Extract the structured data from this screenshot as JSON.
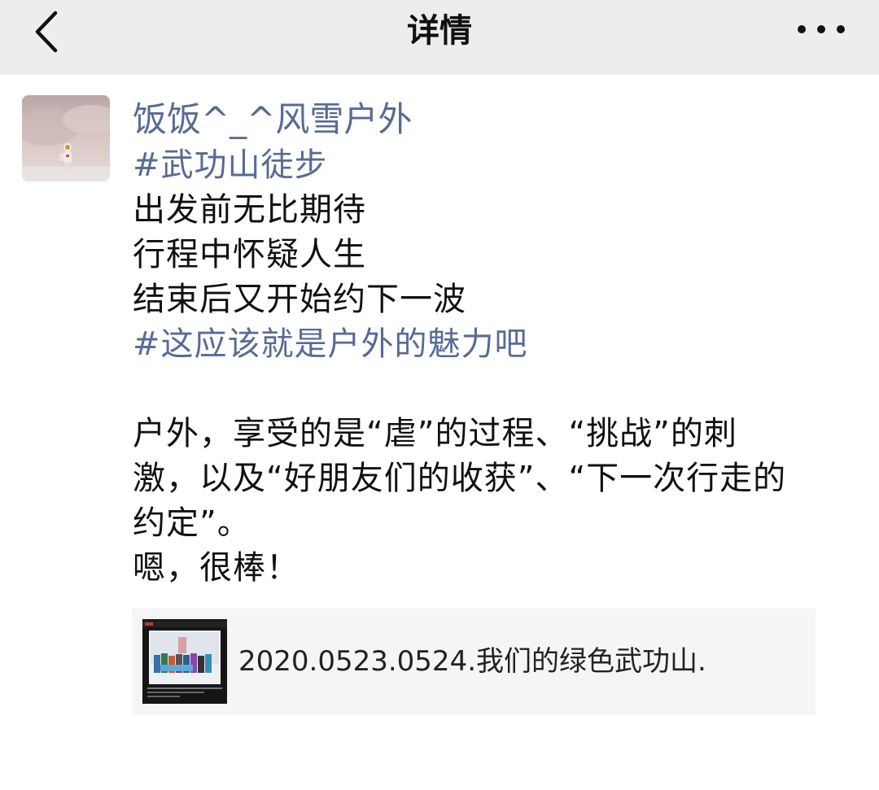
{
  "navbar": {
    "title": "详情",
    "back_icon": "chevron-left-icon",
    "more_icon": "more-horizontal-icon"
  },
  "post": {
    "username": "饭饭^_^风雪户外",
    "lines": [
      {
        "text": "#武功山徒步",
        "tag": true
      },
      {
        "text": "出发前无比期待",
        "tag": false
      },
      {
        "text": "行程中怀疑人生",
        "tag": false
      },
      {
        "text": "结束后又开始约下一波",
        "tag": false
      },
      {
        "text": "#这应该就是户外的魅力吧",
        "tag": true
      },
      {
        "text": "",
        "tag": false
      },
      {
        "text": "户外，享受的是“虐”的过程、“挑战”的刺",
        "tag": false
      },
      {
        "text": "激，以及“好朋友们的收获”、“下一次行走的",
        "tag": false
      },
      {
        "text": "约定”。",
        "tag": false
      },
      {
        "text": "嗯，很棒！",
        "tag": false
      }
    ],
    "link": {
      "title": "2020.0523.0524.我们的绿色武功山."
    }
  },
  "colors": {
    "navbar_bg": "#ededed",
    "link_blue": "#576b95",
    "card_bg": "#f5f5f5"
  }
}
